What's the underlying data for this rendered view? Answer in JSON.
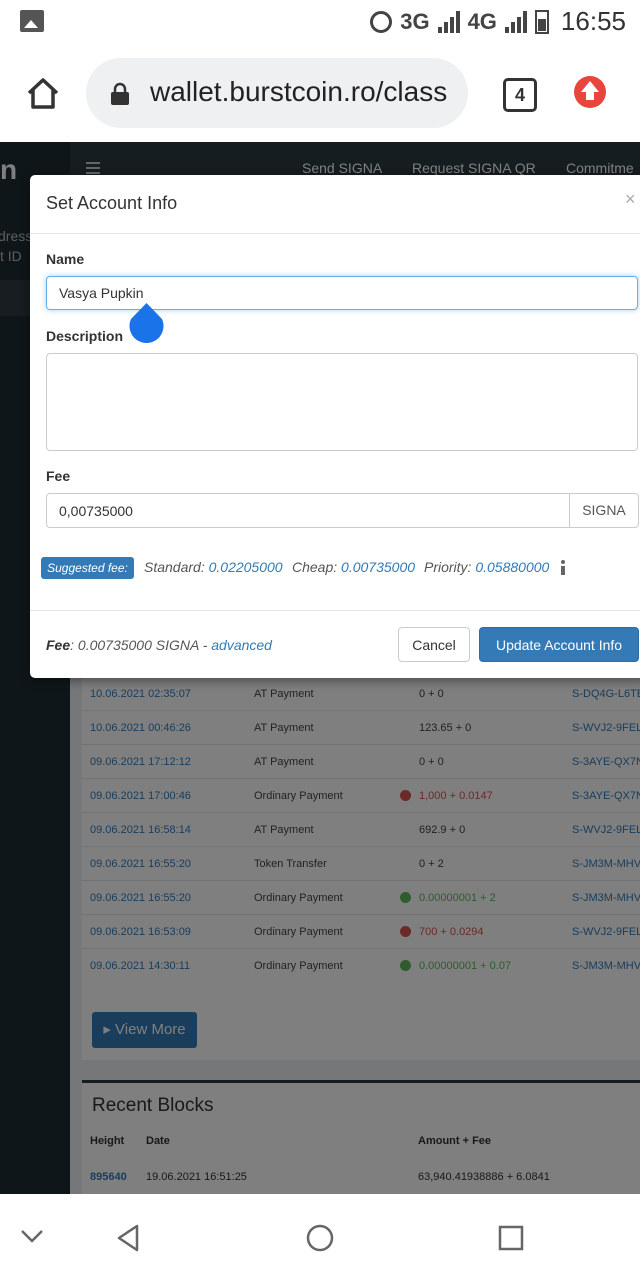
{
  "status_bar": {
    "network_3g": "3G",
    "network_4g": "4G",
    "time": "16:55"
  },
  "browser": {
    "url": "wallet.burstcoin.ro/class",
    "tab_count": "4"
  },
  "sidebar": {
    "logo_letter": "n",
    "address_fragment": "dress",
    "id_fragment": "t ID"
  },
  "topnav": {
    "links": [
      "Send SIGNA",
      "Request SIGNA QR",
      "Commitme"
    ]
  },
  "transactions": [
    {
      "date": "10.06.2021 02:35:07",
      "type": "AT Payment",
      "amount": "0 + 0",
      "account": "S-DQ4G-L6TE",
      "sign": ""
    },
    {
      "date": "10.06.2021 00:46:26",
      "type": "AT Payment",
      "amount": "123.65 + 0",
      "account": "S-WVJ2-9FEL",
      "sign": ""
    },
    {
      "date": "09.06.2021 17:12:12",
      "type": "AT Payment",
      "amount": "0 + 0",
      "account": "S-3AYE-QX7N",
      "sign": ""
    },
    {
      "date": "09.06.2021 17:00:46",
      "type": "Ordinary Payment",
      "amount": "1,000 + 0.0147",
      "account": "S-3AYE-QX7N",
      "sign": "neg"
    },
    {
      "date": "09.06.2021 16:58:14",
      "type": "AT Payment",
      "amount": "692.9 + 0",
      "account": "S-WVJ2-9FEL",
      "sign": ""
    },
    {
      "date": "09.06.2021 16:55:20",
      "type": "Token Transfer",
      "amount": "0 + 2",
      "account": "S-JM3M-MHV",
      "sign": ""
    },
    {
      "date": "09.06.2021 16:55:20",
      "type": "Ordinary Payment",
      "amount": "0.00000001 + 2",
      "account": "S-JM3M-MHV",
      "sign": "pos"
    },
    {
      "date": "09.06.2021 16:53:09",
      "type": "Ordinary Payment",
      "amount": "700 + 0.0294",
      "account": "S-WVJ2-9FEL",
      "sign": "neg"
    },
    {
      "date": "09.06.2021 14:30:11",
      "type": "Ordinary Payment",
      "amount": "0.00000001 + 0.07",
      "account": "S-JM3M-MHV",
      "sign": "pos"
    }
  ],
  "view_more_label": "View More",
  "recent_blocks": {
    "title": "Recent Blocks",
    "headers": {
      "height": "Height",
      "date": "Date",
      "amount_fee": "Amount + Fee"
    },
    "rows": [
      {
        "height": "895640",
        "date": "19.06.2021 16:51:25",
        "amount_fee": "63,940.41938886 + 6.0841"
      }
    ]
  },
  "modal": {
    "title": "Set Account Info",
    "close": "×",
    "name_label": "Name",
    "name_value": "Vasya Pupkin",
    "description_label": "Description",
    "description_value": "",
    "fee_label": "Fee",
    "fee_value": "0,00735000",
    "fee_unit": "SIGNA",
    "suggested_badge": "Suggested fee:",
    "standard_label": "Standard:",
    "standard_value": "0.02205000",
    "cheap_label": "Cheap:",
    "cheap_value": "0.00735000",
    "priority_label": "Priority:",
    "priority_value": "0.05880000",
    "footer_fee_label": "Fee",
    "footer_fee_value": ": 0.00735000 SIGNA - ",
    "advanced_link": "advanced",
    "cancel_button": "Cancel",
    "update_button": "Update Account Info"
  },
  "colors": {
    "accent": "#337ab7",
    "sidebar": "#1f2d33",
    "negative": "#d9534f",
    "positive": "#5cb85c"
  }
}
